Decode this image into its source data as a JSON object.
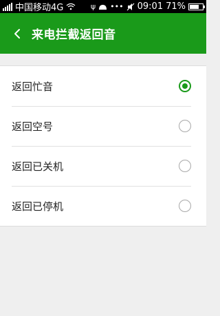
{
  "status_bar": {
    "carrier": "中国移动4G",
    "time": "09:01",
    "battery_percent": "71%",
    "battery_level": 0.71
  },
  "app_bar": {
    "title": "来电拦截返回音",
    "background_color": "#1a9a1a"
  },
  "options": [
    {
      "label": "返回忙音",
      "selected": true
    },
    {
      "label": "返回空号",
      "selected": false
    },
    {
      "label": "返回已关机",
      "selected": false
    },
    {
      "label": "返回已停机",
      "selected": false
    }
  ]
}
